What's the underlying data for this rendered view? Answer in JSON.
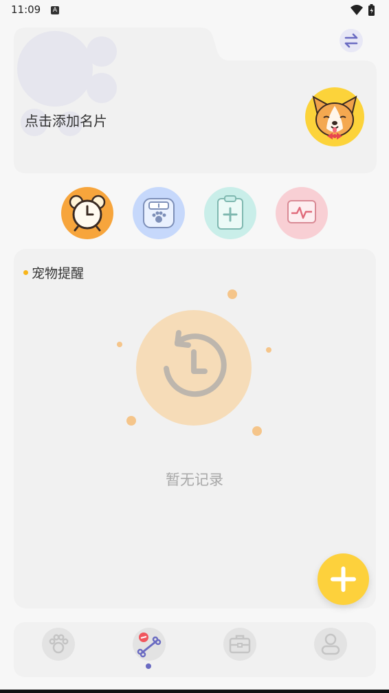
{
  "status_bar": {
    "time": "11:09",
    "notification_badge": "A"
  },
  "profile_card": {
    "prompt": "点击添加名片"
  },
  "features": [
    {
      "name": "alarm-clock-icon",
      "color": "#f7a53c"
    },
    {
      "name": "pet-scale-icon",
      "color": "#c6d8fb"
    },
    {
      "name": "medical-record-icon",
      "color": "#c9eee9"
    },
    {
      "name": "health-monitor-icon",
      "color": "#f8cfd4"
    }
  ],
  "reminder": {
    "title": "宠物提醒",
    "empty_text": "暂无记录"
  },
  "bottom_nav": {
    "items": [
      "paw-icon",
      "bone-pill-icon",
      "toolbox-icon",
      "profile-icon"
    ],
    "active_index": 1
  },
  "colors": {
    "accent_yellow": "#fdd13c",
    "accent_purple": "#6a6bc2"
  }
}
